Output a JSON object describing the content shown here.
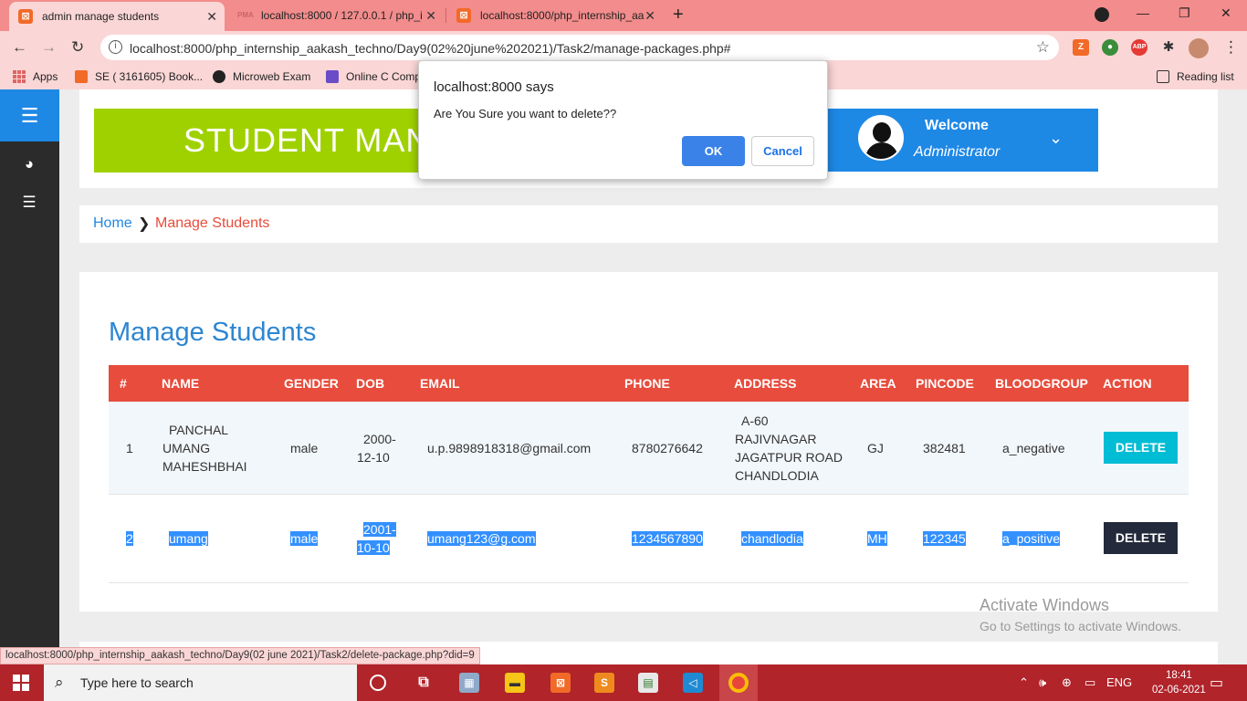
{
  "browser": {
    "tabs": [
      {
        "label": "admin manage students",
        "active": true
      },
      {
        "label": "localhost:8000 / 127.0.0.1 / php_i",
        "active": false
      },
      {
        "label": "localhost:8000/php_internship_aa",
        "active": false
      }
    ],
    "url": "localhost:8000/php_internship_aakash_techno/Day9(02%20june%202021)/Task2/manage-packages.php#",
    "bookmarks": [
      "Apps",
      "SE ( 3161605) Book...",
      "Microweb Exam",
      "Online C Comp"
    ],
    "reading_list": "Reading list",
    "status_url": "localhost:8000/php_internship_aakash_techno/Day9(02 june 2021)/Task2/delete-package.php?did=9"
  },
  "header": {
    "title": "STUDENT MAN",
    "welcome": "Welcome",
    "role": "Administrator"
  },
  "breadcrumb": {
    "home": "Home",
    "sep": "❯",
    "current": "Manage Students"
  },
  "main": {
    "heading": "Manage Students",
    "columns": [
      "#",
      "NAME",
      "GENDER",
      "DOB",
      "EMAIL",
      "PHONE",
      "ADDRESS",
      "AREA",
      "PINCODE",
      "BLOODGROUP",
      "ACTION"
    ],
    "rows": [
      {
        "num": "1",
        "name": [
          "PANCHAL",
          "UMANG",
          "MAHESHBHAI"
        ],
        "gender": "male",
        "dob": [
          "2000-",
          "12-10"
        ],
        "email": "u.p.9898918318@gmail.com",
        "phone": "8780276642",
        "address": [
          "A-60",
          "RAJIVNAGAR",
          "JAGATPUR ROAD",
          "CHANDLODIA"
        ],
        "area": "GJ",
        "pincode": "382481",
        "bloodgroup": "a_negative",
        "action": "DELETE"
      },
      {
        "num": "2",
        "name": [
          "umang"
        ],
        "gender": "male",
        "dob": [
          "2001-",
          "10-10"
        ],
        "email": "umang123@g.com",
        "phone": "1234567890",
        "address": [
          "chandlodia"
        ],
        "area": "MH",
        "pincode": "122345",
        "bloodgroup": "a_positive",
        "action": "DELETE"
      }
    ]
  },
  "dialog": {
    "title": "localhost:8000 says",
    "message": "Are You Sure you want to delete??",
    "ok": "OK",
    "cancel": "Cancel"
  },
  "watermark": {
    "line1": "Activate Windows",
    "line2": "Go to Settings to activate Windows."
  },
  "taskbar": {
    "search_placeholder": "Type here to search",
    "lang": "ENG",
    "time": "18:41",
    "date": "02-06-2021"
  },
  "colors": {
    "accent_blue": "#1e88e5",
    "table_header": "#e74c3c",
    "banner_green": "#9fd100",
    "taskbar": "#b0242a"
  }
}
